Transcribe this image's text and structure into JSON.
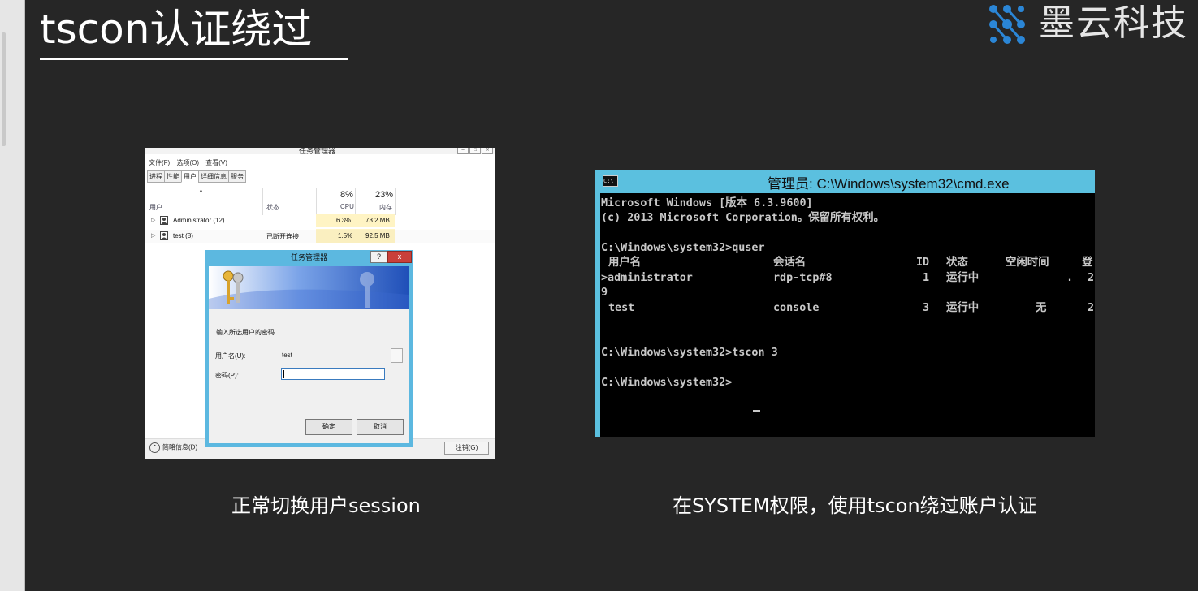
{
  "slide": {
    "title": "tscon认证绕过",
    "logo_text": "墨云科技",
    "caption_left": "正常切换用户session",
    "caption_right": "在SYSTEM权限，使用tscon绕过账户认证",
    "colors": {
      "background": "#262626",
      "logo_accent": "#2b86d6",
      "cmd_titlebar": "#5bc0df"
    }
  },
  "task_manager": {
    "title": "任务管理器",
    "menu": [
      "文件(F)",
      "选项(O)",
      "查看(V)"
    ],
    "tabs": [
      "进程",
      "性能",
      "用户",
      "详细信息",
      "服务"
    ],
    "active_tab": "用户",
    "cpu_percent": "8%",
    "mem_percent": "23%",
    "columns": {
      "user": "用户",
      "status": "状态",
      "cpu": "CPU",
      "mem": "内存"
    },
    "rows": [
      {
        "name": "Administrator (12)",
        "status": "",
        "cpu": "6.3%",
        "mem": "73.2 MB"
      },
      {
        "name": "test (8)",
        "status": "已断开连接",
        "cpu": "1.5%",
        "mem": "92.5 MB"
      }
    ],
    "fewer_details": "简略信息(D)",
    "logoff_button": "注销(G)",
    "dialog": {
      "title": "任务管理器",
      "help": "?",
      "close": "x",
      "prompt": "输入所选用户的密码",
      "username_label": "用户名(U):",
      "username_value": "test",
      "browse": "...",
      "password_label": "密码(P):",
      "password_value": "",
      "ok": "确定",
      "cancel": "取消"
    }
  },
  "cmd": {
    "title": "管理员: C:\\Windows\\system32\\cmd.exe",
    "icon_text": "C:\\",
    "lines": [
      "Microsoft Windows [版本 6.3.9600]",
      "(c) 2013 Microsoft Corporation。保留所有权利。",
      "",
      "C:\\Windows\\system32>quser",
      "",
      "",
      "9",
      "",
      "",
      "",
      "",
      "C:\\Windows\\system32>tscon 3",
      "",
      "C:\\Windows\\system32>"
    ],
    "quser_header": {
      "user": "用户名",
      "session": "会话名",
      "id": "ID",
      "state": "状态",
      "idle": "空闲时间",
      "logon": "登"
    },
    "quser_rows": [
      {
        "user": ">administrator",
        "session": "rdp-tcp#8",
        "id": "1",
        "state": "运行中",
        "idle": ".",
        "logon": "2"
      },
      {
        "user": "test",
        "session": "console",
        "id": "3",
        "state": "运行中",
        "idle": "无",
        "logon": "2"
      }
    ]
  }
}
